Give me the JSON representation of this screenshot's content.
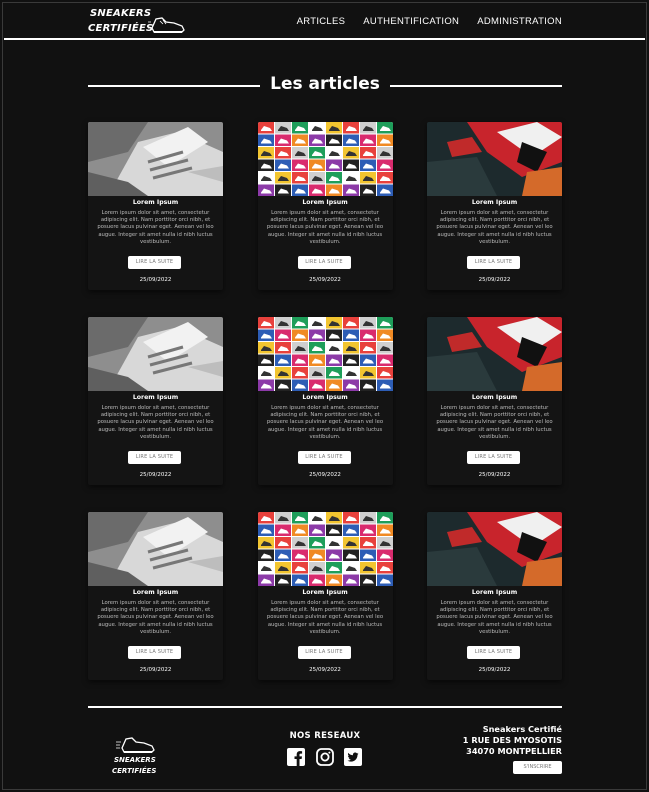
{
  "header": {
    "logo_line1": "SNEAKERS",
    "logo_line2": "CERTIFIÉES",
    "nav": [
      "ARTICLES",
      "AUTHENTIFICATION",
      "ADMINISTRATION"
    ]
  },
  "main": {
    "title": "Les articles",
    "articles": [
      {
        "title": "Lorem Ipsum",
        "image": "grey-sneaker",
        "text": "Lorem ipsum dolor sit amet, consectetur adipiscing elit. Nam porttitor orci nibh, et posuere lacus pulvinar eget. Aenean vel leo augue. Integer sit amet nulla id nibh luctus vestibulum.",
        "button": "LIRE LA SUITE",
        "date": "25/09/2022"
      },
      {
        "title": "Lorem Ipsum",
        "image": "mosaic-sneakers",
        "text": "Lorem ipsum dolor sit amet, consectetur adipiscing elit. Nam porttitor orci nibh, et posuere lacus pulvinar eget. Aenean vel leo augue. Integer sit amet nulla id nibh luctus vestibulum.",
        "button": "LIRE LA SUITE",
        "date": "25/09/2022"
      },
      {
        "title": "Lorem Ipsum",
        "image": "red-sneaker",
        "text": "Lorem ipsum dolor sit amet, consectetur adipiscing elit. Nam porttitor orci nibh, et posuere lacus pulvinar eget. Aenean vel leo augue. Integer sit amet nulla id nibh luctus vestibulum.",
        "button": "LIRE LA SUITE",
        "date": "25/09/2022"
      },
      {
        "title": "Lorem Ipsum",
        "image": "grey-sneaker",
        "text": "Lorem ipsum dolor sit amet, consectetur adipiscing elit. Nam porttitor orci nibh, et posuere lacus pulvinar eget. Aenean vel leo augue. Integer sit amet nulla id nibh luctus vestibulum.",
        "button": "LIRE LA SUITE",
        "date": "25/09/2022"
      },
      {
        "title": "Lorem Ipsum",
        "image": "mosaic-sneakers",
        "text": "Lorem ipsum dolor sit amet, consectetur adipiscing elit. Nam porttitor orci nibh, et posuere lacus pulvinar eget. Aenean vel leo augue. Integer sit amet nulla id nibh luctus vestibulum.",
        "button": "LIRE LA SUITE",
        "date": "25/09/2022"
      },
      {
        "title": "Lorem Ipsum",
        "image": "red-sneaker",
        "text": "Lorem ipsum dolor sit amet, consectetur adipiscing elit. Nam porttitor orci nibh, et posuere lacus pulvinar eget. Aenean vel leo augue. Integer sit amet nulla id nibh luctus vestibulum.",
        "button": "LIRE LA SUITE",
        "date": "25/09/2022"
      },
      {
        "title": "Lorem Ipsum",
        "image": "grey-sneaker",
        "text": "Lorem ipsum dolor sit amet, consectetur adipiscing elit. Nam porttitor orci nibh, et posuere lacus pulvinar eget. Aenean vel leo augue. Integer sit amet nulla id nibh luctus vestibulum.",
        "button": "LIRE LA SUITE",
        "date": "25/09/2022"
      },
      {
        "title": "Lorem Ipsum",
        "image": "mosaic-sneakers",
        "text": "Lorem ipsum dolor sit amet, consectetur adipiscing elit. Nam porttitor orci nibh, et posuere lacus pulvinar eget. Aenean vel leo augue. Integer sit amet nulla id nibh luctus vestibulum.",
        "button": "LIRE LA SUITE",
        "date": "25/09/2022"
      },
      {
        "title": "Lorem Ipsum",
        "image": "red-sneaker",
        "text": "Lorem ipsum dolor sit amet, consectetur adipiscing elit. Nam porttitor orci nibh, et posuere lacus pulvinar eget. Aenean vel leo augue. Integer sit amet nulla id nibh luctus vestibulum.",
        "button": "LIRE LA SUITE",
        "date": "25/09/2022"
      }
    ]
  },
  "footer": {
    "logo_line1": "SNEAKERS",
    "logo_line2": "CERTIFIÉES",
    "social_title": "NOS RESEAUX",
    "socials": [
      "facebook-icon",
      "instagram-icon",
      "twitter-icon"
    ],
    "address": [
      "Sneakers Certifié",
      "1 RUE DES MYOSOTIS",
      "34070 MONTPELLIER"
    ],
    "subscribe_label": "S'INSCRIRE"
  },
  "colors": {
    "background": "#111111",
    "text": "#ffffff",
    "card": "#141414"
  }
}
